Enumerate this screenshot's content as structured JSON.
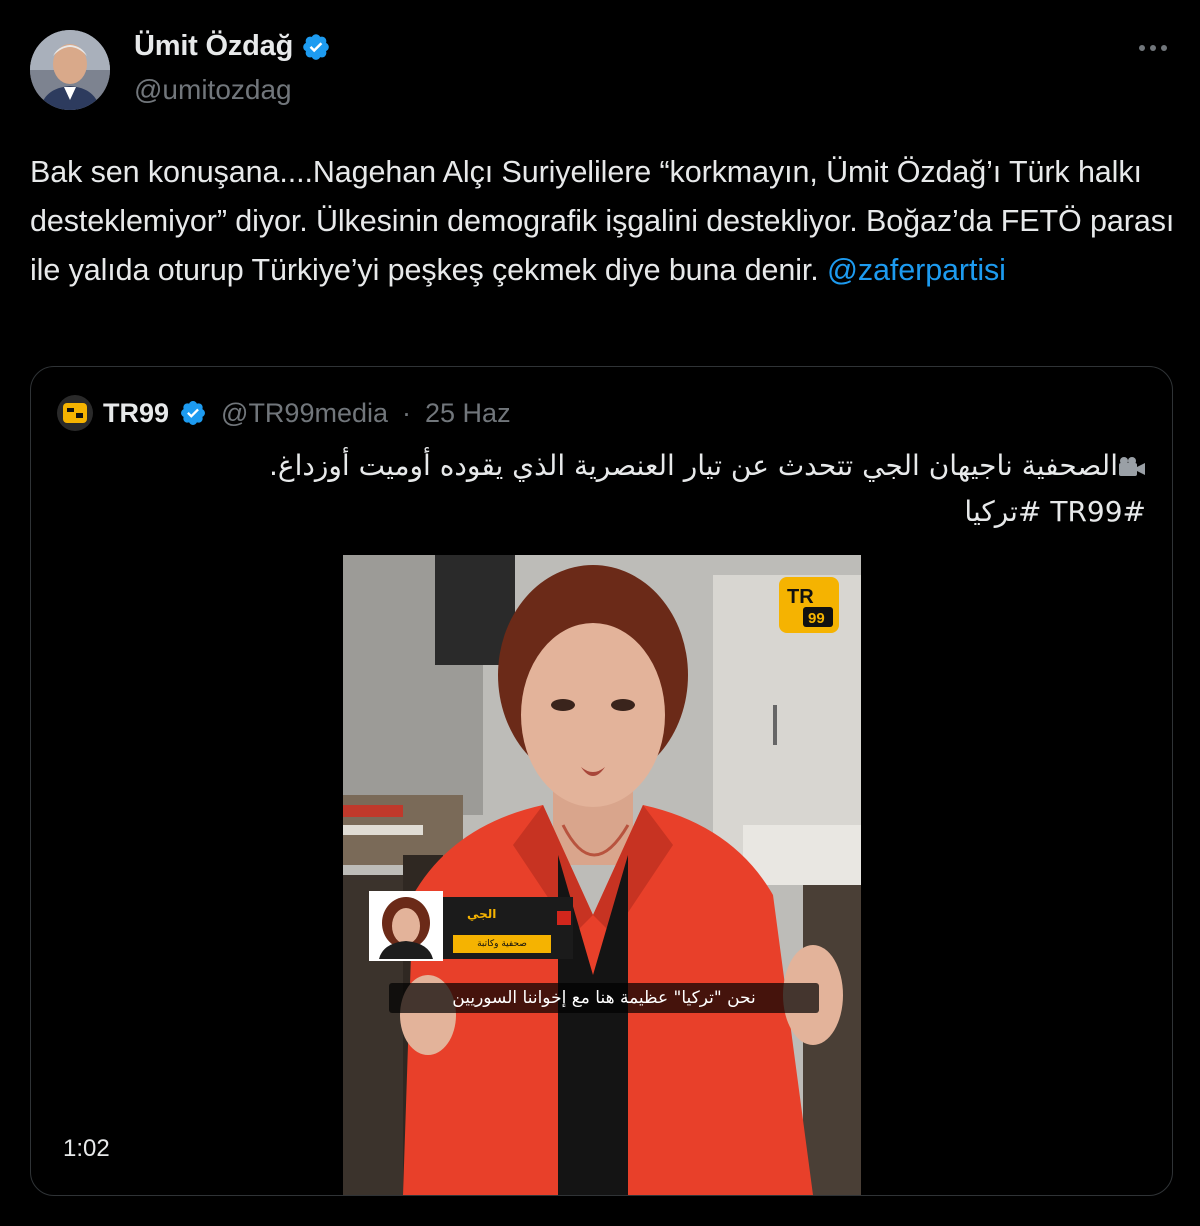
{
  "author": {
    "display_name": "Ümit Özdağ",
    "handle": "@umitozdag",
    "verified_icon": "verified-badge-icon",
    "avatar_icon": "avatar-photo"
  },
  "more_icon": "more-options-icon",
  "tweet": {
    "text_before_mention": "Bak sen konuşana....Nagehan Alçı Suriyelilere “korkmayın, Ümit Özdağ’ı Türk halkı desteklemiyor” diyor. Ülkesinin demografik işgalini destekliyor. Boğaz’da FETÖ parası ile yalıda oturup Türkiye’yi peşkeş çekmek diye buna denir. ",
    "mention": "@zaferpartisi"
  },
  "quote": {
    "display_name": "TR99",
    "handle": "@TR99media",
    "separator": "·",
    "date": "25 Haz",
    "text_line1": "الصحفية ناجيهان الجي تتحدث عن تيار العنصرية الذي يقوده أوميت أوزداغ.",
    "text_line2": "#TR99 #تركيا",
    "video_icon": "film-camera-icon",
    "media": {
      "duration": "1:02",
      "badge_text": "TR",
      "badge_sub": "99",
      "lower_third_name": "الجي",
      "lower_third_role": "صحفية وكاتبة",
      "subtitle": "نحن \"تركيا\" عظيمة هنا مع إخواننا السوريين"
    }
  },
  "colors": {
    "background": "#000000",
    "text": "#e7e9ea",
    "secondary": "#71767b",
    "link": "#1d9bf0",
    "verified": "#1d9bf0",
    "border": "#2f3336",
    "tr99_yellow": "#f5b301",
    "jacket_red": "#e8402a"
  }
}
